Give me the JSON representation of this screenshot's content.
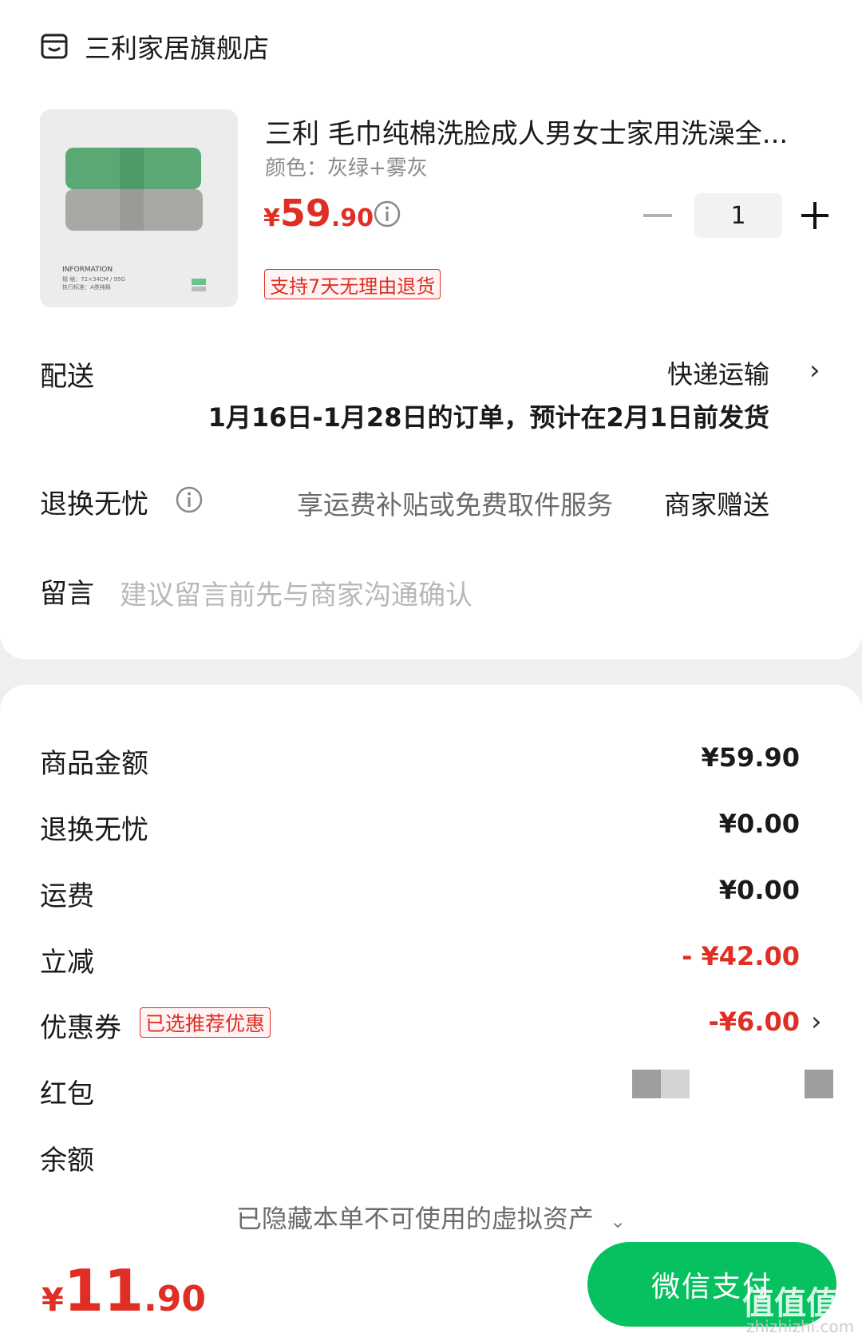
{
  "store": {
    "name": "三利家居旗舰店",
    "icon": "store-icon"
  },
  "product": {
    "title": "三利 毛巾纯棉洗脸成人男女士家用洗澡全...",
    "color": "颜色：灰绿+雾灰",
    "price_yen": "¥",
    "price_int": "59",
    "price_dec": ".90",
    "quantity": "1",
    "return_tag": "支持7天无理由退货",
    "thumb_label": "INFORMATION",
    "thumb_spec": "规  格：72×34CM / 95G",
    "thumb_std": "执行标准：A类纯棉"
  },
  "delivery": {
    "label": "配送",
    "method": "快递运输",
    "note": "1月16日-1月28日的订单，预计在2月1日前发货"
  },
  "service": {
    "label": "退换无忧",
    "desc": "享运费补贴或免费取件服务",
    "value": "商家赠送"
  },
  "message": {
    "label": "留言",
    "placeholder": "建议留言前先与商家沟通确认"
  },
  "summary": [
    {
      "label": "商品金额",
      "amount": "¥59.90"
    },
    {
      "label": "退换无忧",
      "amount": "¥0.00"
    },
    {
      "label": "运费",
      "amount": "¥0.00"
    },
    {
      "label": "立减",
      "amount": "- ¥42.00"
    },
    {
      "label": "优惠券",
      "amount": "-¥6.00",
      "tag": "已选推荐优惠"
    },
    {
      "label": "红包",
      "amount": ""
    },
    {
      "label": "余额",
      "amount": ""
    }
  ],
  "hidden_assets": "已隐藏本单不可使用的虚拟资产",
  "footer": {
    "total_yen": "¥",
    "total_int": "11",
    "total_dec": ".90",
    "pay_label": "微信支付"
  },
  "watermark": {
    "text": "值值值",
    "sub": "zhizhizhi.com"
  },
  "colors": {
    "accent_red": "#e02e24",
    "wechat_green": "#07c160"
  }
}
